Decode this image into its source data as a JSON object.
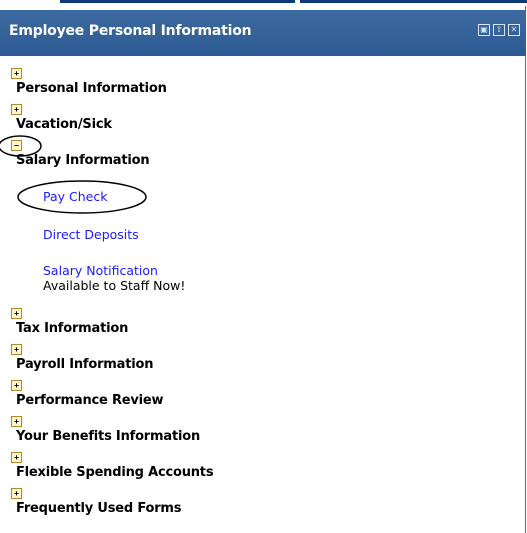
{
  "portlet": {
    "title": "Employee Personal Information",
    "controls": [
      "restore-icon",
      "move-icon",
      "close-icon"
    ]
  },
  "sections": [
    {
      "label": "Personal Information",
      "expanded": false,
      "toggle": "+"
    },
    {
      "label": "Vacation/Sick",
      "expanded": false,
      "toggle": "+"
    },
    {
      "label": "Salary Information",
      "expanded": true,
      "toggle": "−",
      "items": [
        {
          "label": "Pay Check"
        },
        {
          "label": "Direct Deposits"
        },
        {
          "label": "Salary Notification",
          "note": "Available to Staff Now!"
        }
      ]
    },
    {
      "label": "Tax Information",
      "expanded": false,
      "toggle": "+"
    },
    {
      "label": "Payroll Information",
      "expanded": false,
      "toggle": "+"
    },
    {
      "label": "Performance Review",
      "expanded": false,
      "toggle": "+"
    },
    {
      "label": "Your Benefits Information",
      "expanded": false,
      "toggle": "+"
    },
    {
      "label": "Flexible Spending Accounts",
      "expanded": false,
      "toggle": "+"
    },
    {
      "label": "Frequently Used Forms",
      "expanded": false,
      "toggle": "+"
    }
  ],
  "colors": {
    "titlebar": "#2f5e95",
    "link": "#1a1aff",
    "annotation": "#000000"
  }
}
